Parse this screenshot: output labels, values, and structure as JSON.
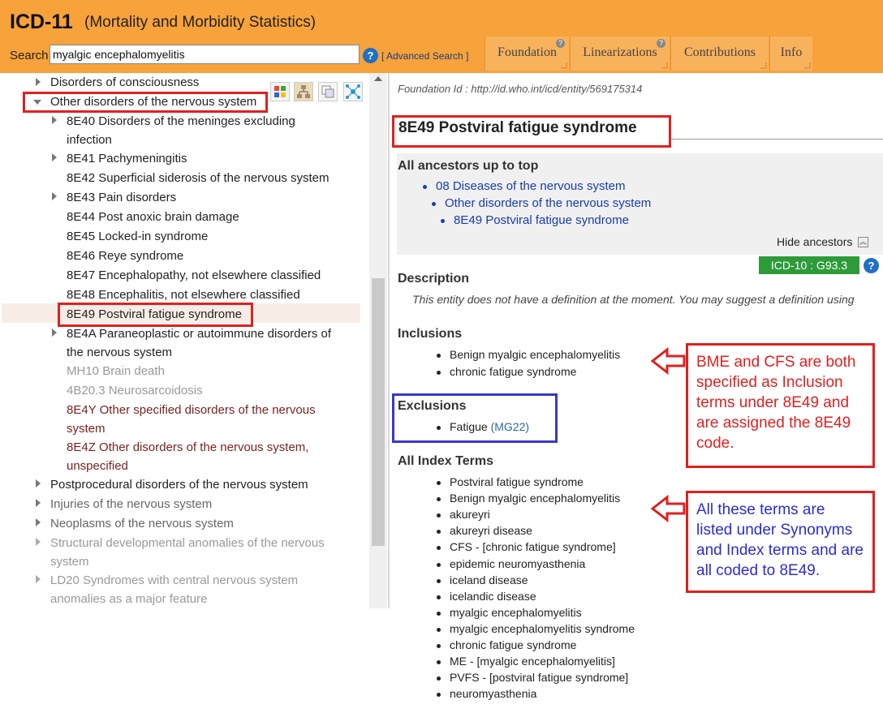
{
  "header": {
    "title": "ICD-11",
    "subtitle": "(Mortality and Morbidity Statistics)",
    "search_label": "Search",
    "search_value": "myalgic encephalomyelitis",
    "help_symbol": "?",
    "advanced_search": "[ Advanced Search ]",
    "tabs": [
      {
        "label": "Foundation"
      },
      {
        "label": "Linearizations"
      },
      {
        "label": "Contributions"
      },
      {
        "label": "Info"
      }
    ]
  },
  "tree": {
    "items": [
      {
        "text": "Disorders of consciousness"
      },
      {
        "text": "Other disorders of the nervous system"
      },
      {
        "code": "8E40",
        "text": "Disorders of the meninges excluding",
        "text2": "infection"
      },
      {
        "code": "8E41",
        "text": "Pachymeningitis"
      },
      {
        "code": "8E42",
        "text": "Superficial siderosis of the nervous system"
      },
      {
        "code": "8E43",
        "text": "Pain disorders"
      },
      {
        "code": "8E44",
        "text": "Post anoxic brain damage"
      },
      {
        "code": "8E45",
        "text": "Locked-in syndrome"
      },
      {
        "code": "8E46",
        "text": "Reye syndrome"
      },
      {
        "code": "8E47",
        "text": "Encephalopathy, not elsewhere classified"
      },
      {
        "code": "8E48",
        "text": "Encephalitis, not elsewhere classified"
      },
      {
        "code": "8E49",
        "text": "Postviral fatigue syndrome"
      },
      {
        "code": "8E4A",
        "text": "Paraneoplastic or autoimmune disorders of",
        "text2": "the nervous system"
      },
      {
        "code": "MH10",
        "text": "Brain death"
      },
      {
        "code": "4B20.3",
        "text": "Neurosarcoidosis"
      },
      {
        "code": "8E4Y",
        "text": "Other specified disorders of the nervous",
        "text2": "system"
      },
      {
        "code": "8E4Z",
        "text": "Other disorders of the nervous system,",
        "text2": "unspecified"
      },
      {
        "text": "Postprocedural disorders of the nervous system"
      },
      {
        "text": "Injuries of the nervous system"
      },
      {
        "text": "Neoplasms of the nervous system"
      },
      {
        "text": "Structural developmental anomalies of the nervous",
        "text2": "system"
      },
      {
        "code": "LD20",
        "text": "Syndromes with central nervous system",
        "text2": "anomalies as a major feature"
      }
    ]
  },
  "entity": {
    "foundation_id": "Foundation Id : http://id.who.int/icd/entity/569175314",
    "title": "8E49 Postviral fatigue syndrome",
    "ancestors_heading": "All ancestors up to top",
    "ancestors": [
      "08 Diseases of the nervous system",
      "Other disorders of the nervous system",
      "8E49 Postviral fatigue syndrome"
    ],
    "hide_ancestors": "Hide ancestors",
    "icd10_badge": "ICD-10 : G93.3",
    "description_heading": "Description",
    "description_text": "This entity does not have a definition at the moment. You may suggest a definition using",
    "inclusions_heading": "Inclusions",
    "inclusions": [
      "Benign myalgic encephalomyelitis",
      "chronic fatigue syndrome"
    ],
    "exclusions_heading": "Exclusions",
    "exclusion_term": "Fatigue",
    "exclusion_code": "(MG22)",
    "index_heading": "All Index Terms",
    "index_terms": [
      "Postviral fatigue syndrome",
      "Benign myalgic encephalomyelitis",
      "akureyri",
      "akureyri disease",
      "CFS - [chronic fatigue syndrome]",
      "epidemic neuromyasthenia",
      "iceland disease",
      "icelandic disease",
      "myalgic encephalomyelitis",
      "myalgic encephalomyelitis syndrome",
      "chronic fatigue syndrome",
      "ME - [myalgic encephalomyelitis]",
      "PVFS - [postviral fatigue syndrome]",
      "neuromyasthenia"
    ]
  },
  "annotations": {
    "note1": "BME and CFS are both specified as Inclusion terms under 8E49 and are assigned the 8E49 code.",
    "note2": "All these terms are listed under Synonyms and Index terms and are all coded to 8E49.",
    "colors": {
      "red": "#e02020",
      "blue": "#3838c8",
      "note2_text": "#2b2bd6"
    }
  },
  "colors": {
    "header_bg": "#f7a23b",
    "tab_bg": "#f9b25c",
    "link": "#1a3bb0",
    "badge_green": "#2e9b3a"
  }
}
